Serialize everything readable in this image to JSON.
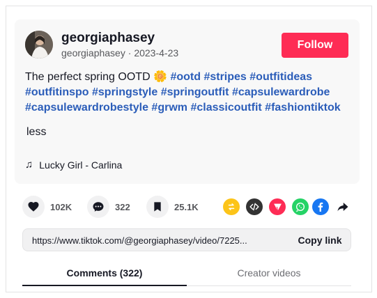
{
  "author": {
    "name": "georgiaphasey",
    "handle": "georgiaphasey",
    "separator": " · ",
    "date": "2023-4-23"
  },
  "follow_label": "Follow",
  "description": {
    "text": "The perfect spring OOTD",
    "emoji": "🌼",
    "hashtags": [
      "#ootd",
      "#stripes",
      "#outfitideas",
      "#outfitinspo",
      "#springstyle",
      "#springoutfit",
      "#capsulewardrobe",
      "#capsulewardrobestyle",
      "#grwm",
      "#classicoutfit",
      "#fashiontiktok"
    ]
  },
  "less_label": "less",
  "music": {
    "icon": "music-note-icon",
    "title": "Lucky Girl - Carlina"
  },
  "stats": {
    "likes": "102K",
    "comments": "322",
    "saves": "25.1K"
  },
  "share_icons": [
    "repost-icon",
    "embed-icon",
    "send-icon",
    "whatsapp-icon",
    "facebook-icon",
    "share-arrow-icon"
  ],
  "colors": {
    "accent": "#fe2c55",
    "hashtag": "#2b5db9",
    "repost": "#fcc419",
    "embed": "#333333",
    "send": "#fe2c55",
    "whatsapp": "#25d366",
    "facebook": "#1877f2"
  },
  "link": {
    "url": "https://www.tiktok.com/@georgiaphasey/video/7225...",
    "copy_label": "Copy link"
  },
  "tabs": {
    "comments": "Comments (322)",
    "creator": "Creator videos"
  }
}
